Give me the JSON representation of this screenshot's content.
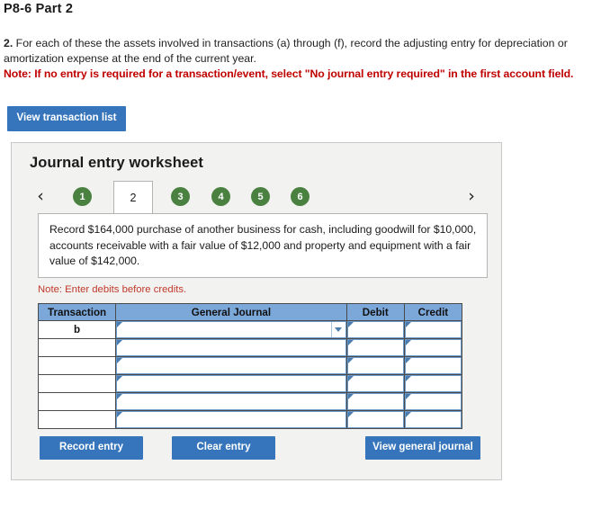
{
  "page": {
    "title": "P8-6 Part 2",
    "instruction_number": "2.",
    "instruction_text": " For each of these the assets involved in transactions (a) through (f), record the adjusting entry for depreciation or amortization expense at the end of the current year.",
    "note_main": "Note: If no entry is required for a transaction/event, select \"No journal entry required\" in the first account field."
  },
  "toolbar": {
    "view_transaction_list_label": "View transaction list"
  },
  "worksheet": {
    "title": "Journal entry worksheet",
    "prev_icon": "chevron-left-icon",
    "next_icon": "chevron-right-icon",
    "tabs": [
      {
        "label": "1",
        "active": false
      },
      {
        "label": "2",
        "active": true
      },
      {
        "label": "3",
        "active": false
      },
      {
        "label": "4",
        "active": false
      },
      {
        "label": "5",
        "active": false
      },
      {
        "label": "6",
        "active": false
      }
    ],
    "description": "Record $164,000 purchase of another business for cash, including goodwill for $10,000, accounts receivable with a fair value of $12,000 and property and equipment with a fair value of $142,000.",
    "note_debits": "Note: Enter debits before credits.",
    "table": {
      "headers": [
        "Transaction",
        "General Journal",
        "Debit",
        "Credit"
      ],
      "rows": [
        {
          "transaction": "b",
          "general_journal": "",
          "debit": "",
          "credit": "",
          "has_dropdown": true
        },
        {
          "transaction": "",
          "general_journal": "",
          "debit": "",
          "credit": "",
          "has_dropdown": false
        },
        {
          "transaction": "",
          "general_journal": "",
          "debit": "",
          "credit": "",
          "has_dropdown": false
        },
        {
          "transaction": "",
          "general_journal": "",
          "debit": "",
          "credit": "",
          "has_dropdown": false
        },
        {
          "transaction": "",
          "general_journal": "",
          "debit": "",
          "credit": "",
          "has_dropdown": false
        },
        {
          "transaction": "",
          "general_journal": "",
          "debit": "",
          "credit": "",
          "has_dropdown": false
        }
      ]
    },
    "actions": {
      "record_entry_label": "Record entry",
      "clear_entry_label": "Clear entry",
      "view_general_journal_label": "View general journal"
    }
  },
  "colors": {
    "button_blue": "#3675bb",
    "tab_green": "#4a8141",
    "table_header_blue": "#7ba7d9",
    "note_red": "#c00000",
    "note_red_light": "#c0392b"
  }
}
